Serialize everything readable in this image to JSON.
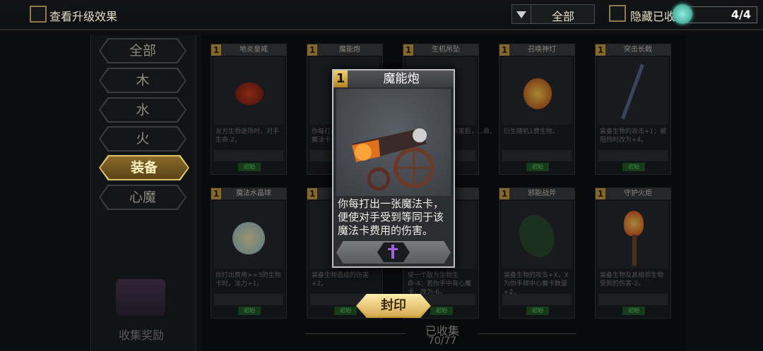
{
  "header": {
    "show_upgrade_label": "查看升级效果",
    "filter_value": "全部",
    "hide_collected_label": "隐藏已收",
    "page_indicator": "4/4"
  },
  "categories": [
    "全部",
    "木",
    "水",
    "火",
    "装备",
    "心魔"
  ],
  "active_category": "装备",
  "collection_reward_label": "收集奖励",
  "collected": {
    "label": "已收集",
    "count": "70/77"
  },
  "cards": [
    {
      "cost": "1",
      "name": "地炎皇戒",
      "desc": "友方生物进场时，对手生命-2。",
      "badge": "初始"
    },
    {
      "cost": "1",
      "name": "魔能炮",
      "desc": "你每打出...便使对手...魔法卡费...",
      "badge": ""
    },
    {
      "cost": "1",
      "name": "生机吊坠",
      "desc": "...伤害后，...命。",
      "badge": ""
    },
    {
      "cost": "1",
      "name": "召唤神灯",
      "desc": "衍生随机1费生物。",
      "badge": "初始"
    },
    {
      "cost": "1",
      "name": "突击长戟",
      "desc": "装备生物的攻击+1；被阻挡时改为+4。",
      "badge": "初始"
    },
    {
      "cost": "1",
      "name": "魔法水晶球",
      "desc": "你打出费用>=3的生物卡时，法力+1。",
      "badge": "初始"
    },
    {
      "cost": "1",
      "name": "",
      "desc": "装备生物造成的伤害+2。",
      "badge": "初始"
    },
    {
      "cost": "",
      "name": "",
      "desc": "使一个敌方生物生命-4；若你手中有心魔卡，改为-6。",
      "badge": "初始"
    },
    {
      "cost": "1",
      "name": "邪能战斧",
      "desc": "装备生物的攻击+X，X为你手牌中心魔卡数量+2。",
      "badge": "初始"
    },
    {
      "cost": "1",
      "name": "守护火炬",
      "desc": "装备生物及其相邻生物受到的伤害-2。",
      "badge": "初始"
    }
  ],
  "popup": {
    "cost": "1",
    "title": "魔能炮",
    "description": "你每打出一张魔法卡，便使对手受到等同于该魔法卡费用的伤害。",
    "art_icon": "cannon-art",
    "slot_icon": "dagger-icon"
  },
  "seal_button": "封印",
  "colors": {
    "accent_gold": "#e2c26b",
    "dagger_purple": "#a060e0",
    "badge_green": "#6fd06f"
  }
}
